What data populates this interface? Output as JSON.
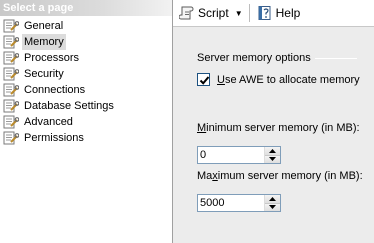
{
  "left_panel": {
    "header": "Select a page",
    "items": [
      {
        "label": "General",
        "selected": false
      },
      {
        "label": "Memory",
        "selected": true
      },
      {
        "label": "Processors",
        "selected": false
      },
      {
        "label": "Security",
        "selected": false
      },
      {
        "label": "Connections",
        "selected": false
      },
      {
        "label": "Database Settings",
        "selected": false
      },
      {
        "label": "Advanced",
        "selected": false
      },
      {
        "label": "Permissions",
        "selected": false
      }
    ]
  },
  "toolbar": {
    "script_label": "Script",
    "help_label": "Help"
  },
  "memory": {
    "group_title": "Server memory options",
    "awe": {
      "label_prefix": "",
      "label_accel": "U",
      "label_rest": "se AWE to allocate memory",
      "checked": true
    },
    "min": {
      "label_accel": "M",
      "label_rest": "inimum server memory (in MB):",
      "value": "0"
    },
    "max": {
      "label_pre": "Ma",
      "label_accel": "x",
      "label_rest": "imum server memory (in MB):",
      "value": "5000"
    }
  },
  "colors": {
    "selected_item_bg": "#dcdcdc",
    "header_text": "#ffffff",
    "right_pane_bg": "#ececec"
  }
}
